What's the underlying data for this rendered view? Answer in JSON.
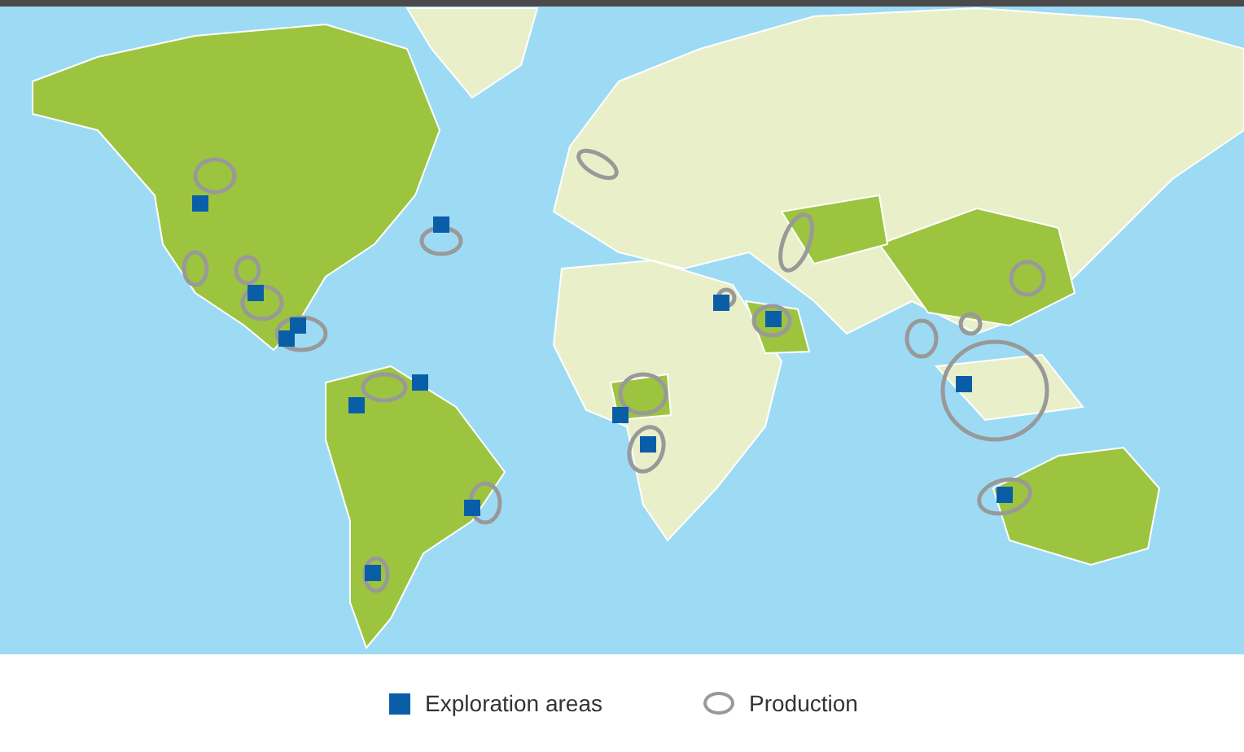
{
  "legend": [
    {
      "kind": "exploration",
      "label": "Exploration areas"
    },
    {
      "kind": "production",
      "label": "Production"
    }
  ]
}
